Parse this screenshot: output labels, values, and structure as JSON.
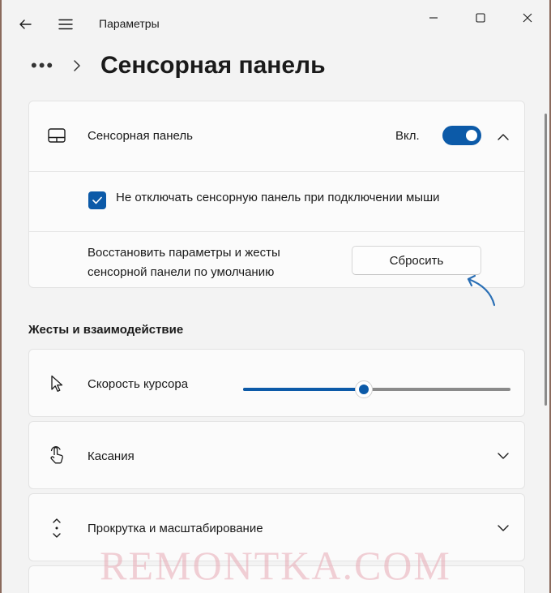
{
  "window": {
    "title": "Параметры",
    "controls": [
      "back-icon",
      "menu-icon",
      "minimize-icon",
      "maximize-icon",
      "close-icon"
    ]
  },
  "breadcrumb": {
    "ellipsis": "•••",
    "page_title": "Сенсорная панель"
  },
  "touchpad": {
    "label": "Сенсорная панель",
    "toggle_state": "Вкл.",
    "toggle_on": true,
    "keep_on_label": "Не отключать сенсорную панель при подключении мыши",
    "keep_on_checked": true,
    "reset_label": "Восстановить параметры и жесты сенсорной панели по умолчанию",
    "reset_button": "Сбросить"
  },
  "gestures": {
    "section_title": "Жесты и взаимодействие",
    "cursor_speed_label": "Скорость курсора",
    "cursor_speed_fraction": 0.45,
    "taps_label": "Касания",
    "scroll_zoom_label": "Прокрутка и масштабирование"
  },
  "watermark": "REMONTKA.COM",
  "colors": {
    "accent": "#0c5aa8",
    "background": "#f3f3f3",
    "card": "#fbfbfb"
  }
}
